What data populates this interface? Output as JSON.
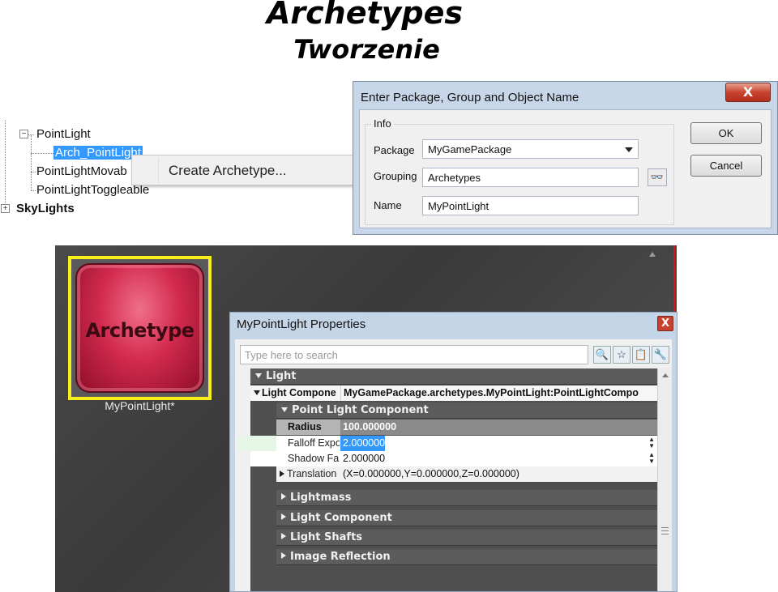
{
  "slide": {
    "title": "Archetypes",
    "subtitle": "Tworzenie"
  },
  "tree": {
    "items": [
      {
        "label": "PointLight",
        "expander": "−"
      },
      {
        "label": "Arch_PointLight",
        "selected": true
      },
      {
        "label": "PointLightMovab"
      },
      {
        "label": "PointLightToggleable"
      },
      {
        "label": "SkyLights",
        "expander": "+"
      }
    ],
    "context_menu": {
      "item": "Create Archetype..."
    }
  },
  "dialog": {
    "title": "Enter Package, Group and Object Name",
    "close_glyph": "X",
    "group_label": "Info",
    "package_label": "Package",
    "package_value": "MyGamePackage",
    "grouping_label": "Grouping",
    "grouping_value": "Archetypes",
    "name_label": "Name",
    "name_value": "MyPointLight",
    "ok_label": "OK",
    "cancel_label": "Cancel"
  },
  "browser": {
    "thumbnail_text": "Archetype",
    "thumbnail_caption": "MyPointLight*",
    "selection_color": "#f6ef1a"
  },
  "properties": {
    "title": "MyPointLight Properties",
    "close_glyph": "X",
    "search_placeholder": "Type here to search",
    "categories": {
      "light": "Light",
      "light_component_name": "Light Compone",
      "light_component_value": "MyGamePackage.archetypes.MyPointLight:PointLightCompo",
      "point_light_component": "Point Light Component",
      "lightmass": "Lightmass",
      "light_component": "Light Component",
      "light_shafts": "Light Shafts",
      "image_reflection": "Image Reflection"
    },
    "rows": [
      {
        "name": "Radius",
        "value": "100.000000"
      },
      {
        "name": "Falloff Expo",
        "value": "2.000000"
      },
      {
        "name": "Shadow Fa",
        "value": "2.000000"
      },
      {
        "name": "Translation",
        "value": "(X=0.000000,Y=0.000000,Z=0.000000)"
      }
    ]
  }
}
